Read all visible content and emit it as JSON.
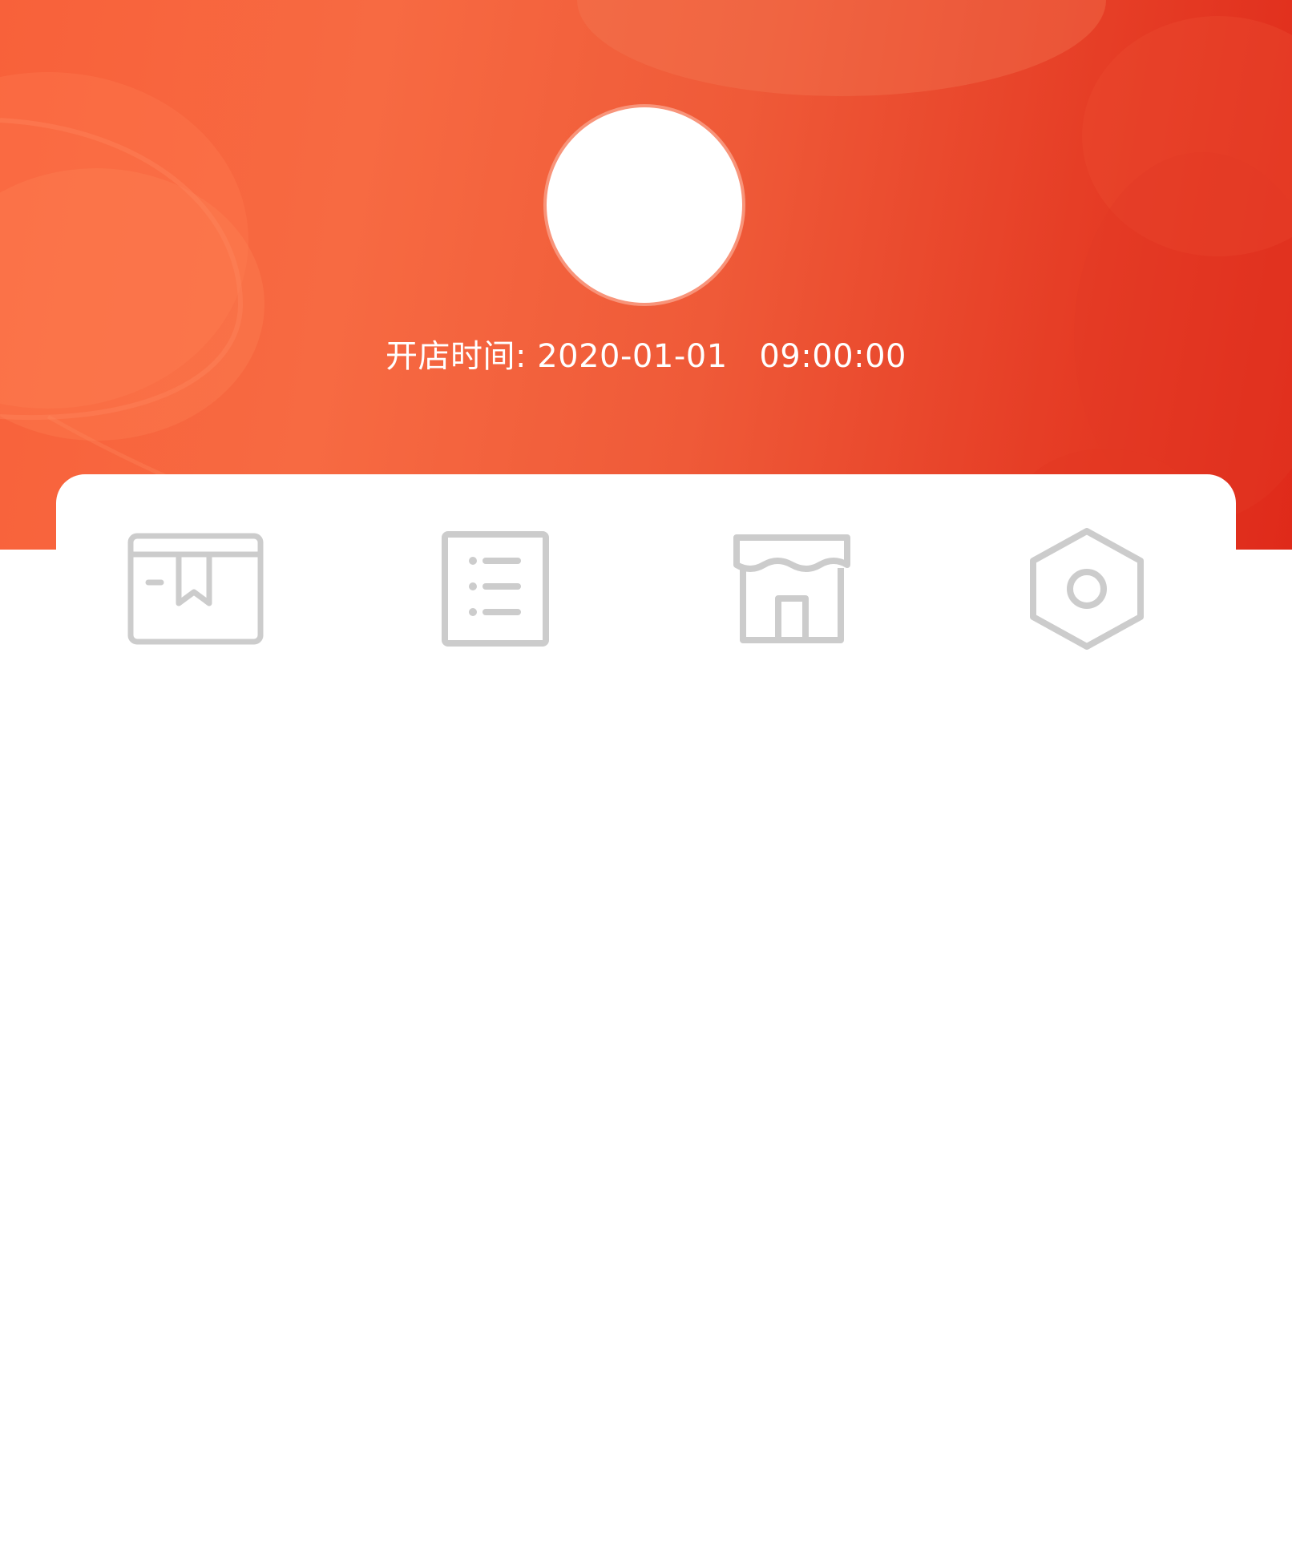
{
  "header": {
    "open_time_label": "开店时间:",
    "open_date": "2020-01-01",
    "open_clock": "09:00:00"
  },
  "menu": {
    "items": [
      {
        "icon": "package-icon",
        "label": ""
      },
      {
        "icon": "list-icon",
        "label": ""
      },
      {
        "icon": "store-icon",
        "label": ""
      },
      {
        "icon": "settings-icon",
        "label": ""
      }
    ]
  },
  "colors": {
    "hero_start": "#f8613a",
    "hero_end": "#df2a1a",
    "icon_gray": "#cccccc",
    "avatar_ring": "#f8947a"
  }
}
